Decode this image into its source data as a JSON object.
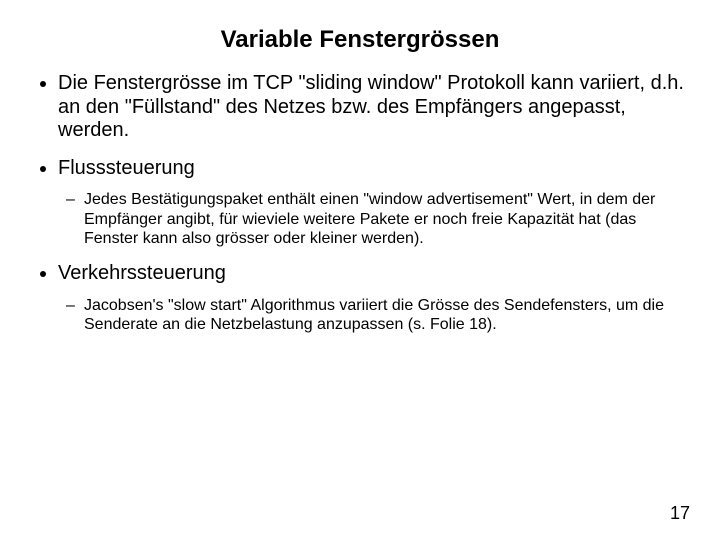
{
  "title": "Variable Fenstergrössen",
  "bullets": [
    {
      "text": "Die Fenstergrösse im TCP \"sliding window\" Protokoll kann variiert, d.h. an den \"Füllstand\" des Netzes bzw. des Empfängers angepasst, werden."
    },
    {
      "text": "Flusssteuerung",
      "sub": [
        "Jedes Bestätigungspaket enthält einen \"window advertisement\" Wert, in dem der Empfänger angibt, für wieviele weitere Pakete er noch freie Kapazität hat (das Fenster kann also grösser oder kleiner werden)."
      ]
    },
    {
      "text": "Verkehrssteuerung",
      "sub": [
        "Jacobsen's \"slow start\" Algorithmus variiert die Grösse des Sendefensters, um die Senderate an die Netzbelastung anzupassen (s. Folie 18)."
      ]
    }
  ],
  "page_number": "17"
}
